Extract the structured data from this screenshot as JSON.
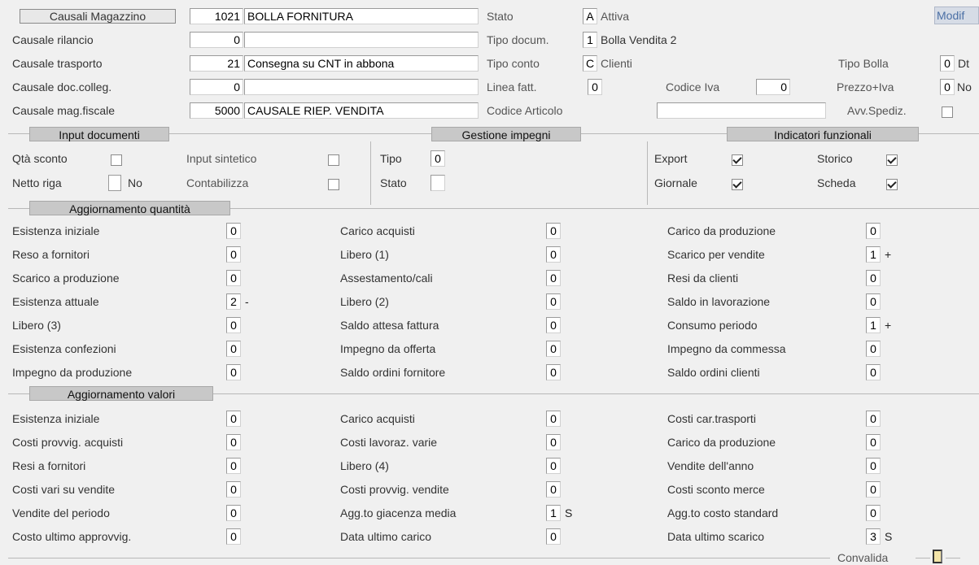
{
  "header": {
    "causali_button": "Causali Magazzino",
    "causali_code": "1021",
    "causali_desc": "BOLLA FORNITURA",
    "stato_label": "Stato",
    "stato_code": "A",
    "stato_desc": "Attiva",
    "modif_label": "Modif"
  },
  "top_left": [
    {
      "label": "Causale rilancio",
      "code": "0",
      "desc": ""
    },
    {
      "label": "Causale trasporto",
      "code": "21",
      "desc": "Consegna su CNT in abbona"
    },
    {
      "label": "Causale doc.colleg.",
      "code": "0",
      "desc": ""
    },
    {
      "label": "Causale mag.fiscale",
      "code": "5000",
      "desc": "CAUSALE RIEP. VENDITA"
    }
  ],
  "top_right": {
    "tipo_docum_label": "Tipo docum.",
    "tipo_docum_code": "1",
    "tipo_docum_desc": "Bolla Vendita 2",
    "tipo_conto_label": "Tipo conto",
    "tipo_conto_code": "C",
    "tipo_conto_desc": "Clienti",
    "tipo_bolla_label": "Tipo Bolla",
    "tipo_bolla_code": "0",
    "tipo_bolla_desc": "Dt",
    "linea_fatt_label": "Linea fatt.",
    "linea_fatt_value": "0",
    "codice_iva_label": "Codice Iva",
    "codice_iva_value": "0",
    "prezzo_iva_label": "Prezzo+Iva",
    "prezzo_iva_code": "0",
    "prezzo_iva_desc": "No",
    "codice_articolo_label": "Codice Articolo",
    "codice_articolo_value": "",
    "avv_spediz_label": "Avv.Spediz."
  },
  "sections": {
    "input_documenti": "Input documenti",
    "gestione_impegni": "Gestione impegni",
    "indicatori_funzionali": "Indicatori funzionali",
    "aggiornamento_quantita": "Aggiornamento quantità",
    "aggiornamento_valori": "Aggiornamento valori"
  },
  "input_documenti": {
    "qta_sconto": "Qtà sconto",
    "input_sintetico": "Input sintetico",
    "netto_riga": "Netto riga",
    "netto_riga_desc": "No",
    "contabilizza": "Contabilizza"
  },
  "gestione_impegni": {
    "tipo_label": "Tipo",
    "tipo_value": "0",
    "stato_label": "Stato",
    "stato_value": ""
  },
  "indicatori": {
    "export": "Export",
    "storico": "Storico",
    "giornale": "Giornale",
    "scheda": "Scheda",
    "export_checked": true,
    "storico_checked": true,
    "giornale_checked": true,
    "scheda_checked": true
  },
  "quantita": [
    {
      "label": "Esistenza iniziale",
      "value": "0",
      "sign": ""
    },
    {
      "label": "Carico acquisti",
      "value": "0",
      "sign": ""
    },
    {
      "label": "Carico da produzione",
      "value": "0",
      "sign": ""
    },
    {
      "label": "Reso   a fornitori",
      "value": "0",
      "sign": ""
    },
    {
      "label": "Libero (1)",
      "value": "0",
      "sign": ""
    },
    {
      "label": "Scarico per vendite",
      "value": "1",
      "sign": "+"
    },
    {
      "label": "Scarico a produzione",
      "value": "0",
      "sign": ""
    },
    {
      "label": "Assestamento/cali",
      "value": "0",
      "sign": ""
    },
    {
      "label": "Resi  da clienti",
      "value": "0",
      "sign": ""
    },
    {
      "label": "Esistenza attuale",
      "value": "2",
      "sign": "-"
    },
    {
      "label": "Libero (2)",
      "value": "0",
      "sign": ""
    },
    {
      "label": "Saldo in lavorazione",
      "value": "0",
      "sign": ""
    },
    {
      "label": "Libero (3)",
      "value": "0",
      "sign": ""
    },
    {
      "label": "Saldo attesa fattura",
      "value": "0",
      "sign": ""
    },
    {
      "label": "Consumo periodo",
      "value": "1",
      "sign": "+"
    },
    {
      "label": "Esistenza confezioni",
      "value": "0",
      "sign": ""
    },
    {
      "label": "Impegno da offerta",
      "value": "0",
      "sign": ""
    },
    {
      "label": "Impegno da commessa",
      "value": "0",
      "sign": ""
    },
    {
      "label": "Impegno da produzione",
      "value": "0",
      "sign": ""
    },
    {
      "label": "Saldo ordini fornitore",
      "value": "0",
      "sign": ""
    },
    {
      "label": "Saldo ordini clienti",
      "value": "0",
      "sign": ""
    }
  ],
  "valori": [
    {
      "label": "Esistenza iniziale",
      "value": "0",
      "sign": ""
    },
    {
      "label": "Carico acquisti",
      "value": "0",
      "sign": ""
    },
    {
      "label": "Costi  car.trasporti",
      "value": "0",
      "sign": ""
    },
    {
      "label": "Costi provvig. acquisti",
      "value": "0",
      "sign": ""
    },
    {
      "label": "Costi lavoraz. varie",
      "value": "0",
      "sign": ""
    },
    {
      "label": "Carico da produzione",
      "value": "0",
      "sign": ""
    },
    {
      "label": "Resi a fornitori",
      "value": "0",
      "sign": ""
    },
    {
      "label": "Libero (4)",
      "value": "0",
      "sign": ""
    },
    {
      "label": "Vendite dell'anno",
      "value": "0",
      "sign": ""
    },
    {
      "label": "Costi vari su vendite",
      "value": "0",
      "sign": ""
    },
    {
      "label": "Costi provvig. vendite",
      "value": "0",
      "sign": ""
    },
    {
      "label": "Costi sconto merce",
      "value": "0",
      "sign": ""
    },
    {
      "label": "Vendite del periodo",
      "value": "0",
      "sign": ""
    },
    {
      "label": "Agg.to giacenza media",
      "value": "1",
      "sign": "S"
    },
    {
      "label": "Agg.to costo standard",
      "value": "0",
      "sign": ""
    },
    {
      "label": "Costo ultimo approvvig.",
      "value": "0",
      "sign": ""
    },
    {
      "label": "Data ultimo carico",
      "value": "0",
      "sign": ""
    },
    {
      "label": "Data ultimo scarico",
      "value": "3",
      "sign": "S"
    }
  ],
  "footer": {
    "convalida_label": "Convalida"
  }
}
